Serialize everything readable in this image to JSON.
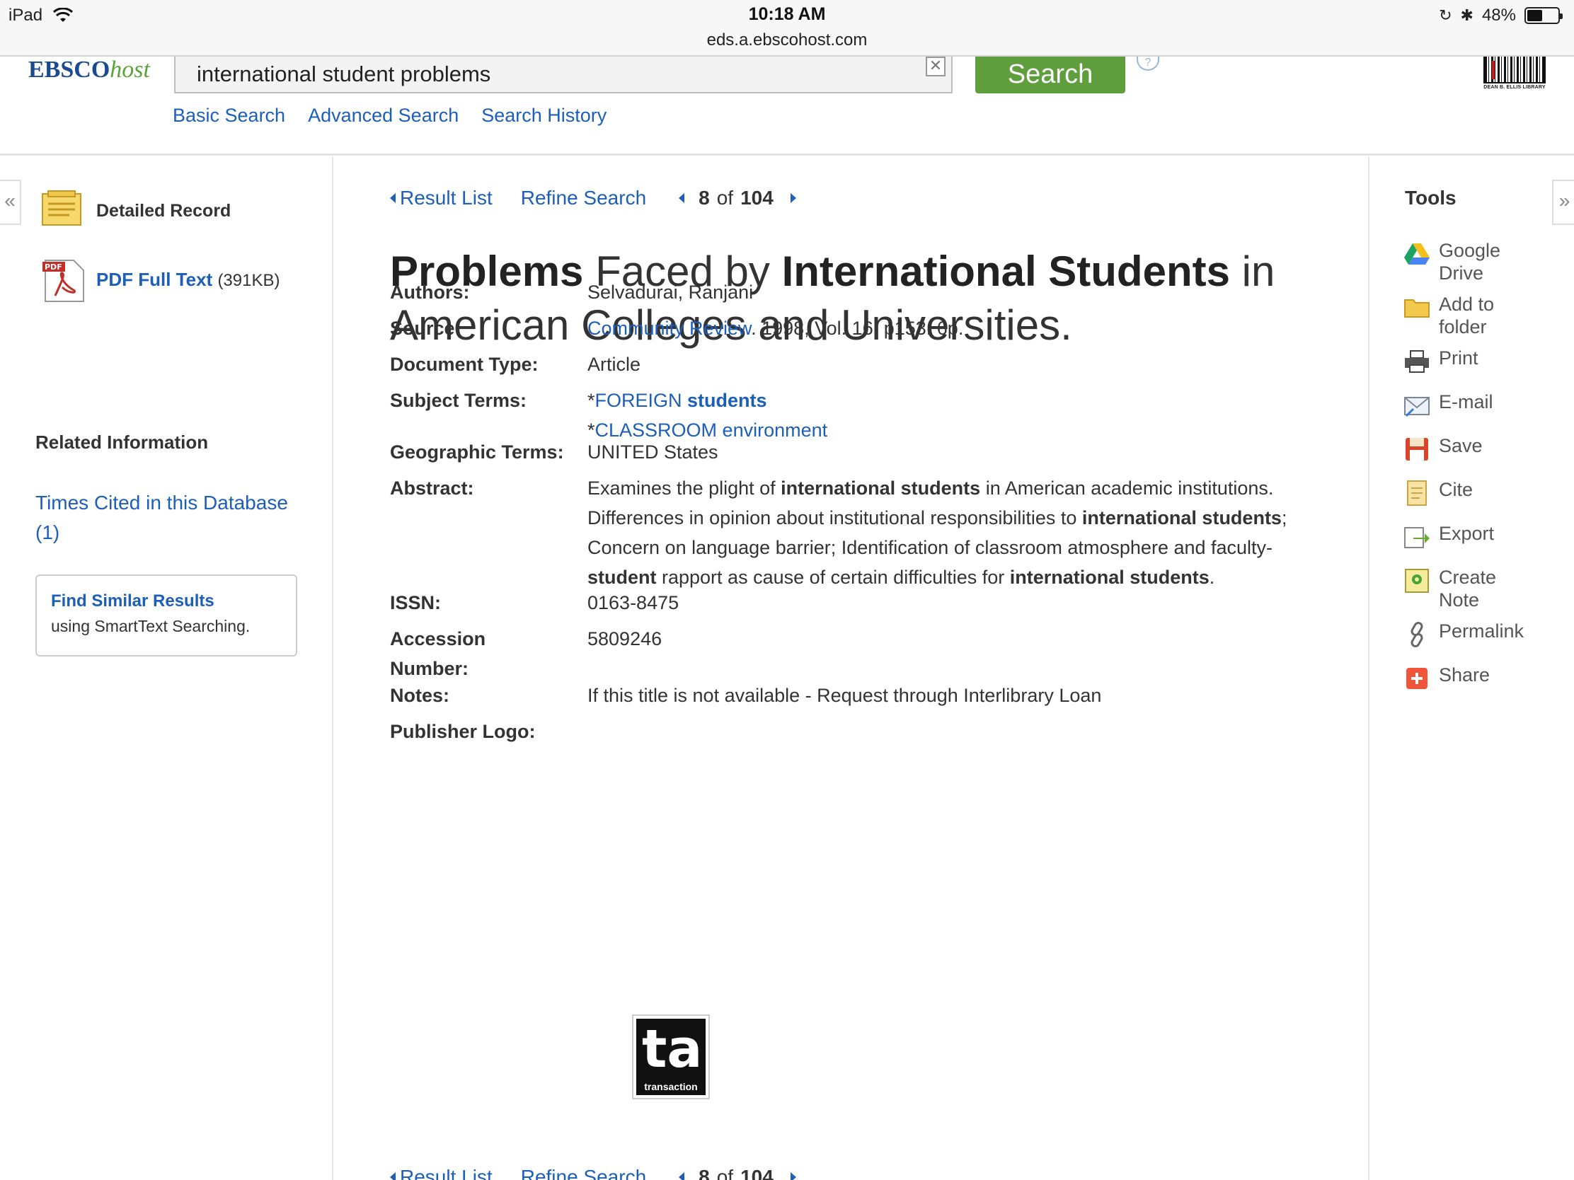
{
  "status_bar": {
    "device": "iPad",
    "time": "10:18 AM",
    "url": "eds.a.ebscohost.com",
    "battery": "48%",
    "battery_level": 0.48
  },
  "header": {
    "logo_main": "EBSCO",
    "logo_sub": "host",
    "search_value": "international student problems",
    "search_button": "Search",
    "links": [
      "Basic Search",
      "Advanced Search",
      "Search History"
    ],
    "library_logo_caption": "DEAN B. ELLIS LIBRARY"
  },
  "left_panel": {
    "detailed_record": "Detailed Record",
    "pdf_link": "PDF Full Text",
    "pdf_size": "(391KB)",
    "pdf_badge": "PDF",
    "related_title": "Related Information",
    "times_cited": "Times Cited in this Database (1)",
    "similar_title": "Find Similar Results",
    "similar_sub": "using SmartText Searching."
  },
  "main": {
    "nav": {
      "result_list": "Result List",
      "refine_search": "Refine Search",
      "current": "8",
      "of": "of",
      "total": "104"
    },
    "title": {
      "p1": "Problems",
      "p2": " Faced by ",
      "p3": "International Students",
      "p4": " in American Colleges and Universities."
    },
    "fields": {
      "authors_label": "Authors:",
      "authors_value": "Selvadurai, Ranjani",
      "source_label": "Source:",
      "source_link": "Community Review",
      "source_rest": ". 1998, Vol. 16, p153. 6p.",
      "doctype_label": "Document Type:",
      "doctype_value": "Article",
      "subject_label": "Subject Terms:",
      "subject1_a": "FOREIGN ",
      "subject1_b": "students",
      "subject2": "CLASSROOM environment",
      "geo_label": "Geographic Terms:",
      "geo_value": "UNITED States",
      "abstract_label": "Abstract:",
      "abstract": [
        "Examines the plight of ",
        "international students",
        " in American academic institutions. Differences in opinion about institutional responsibilities to ",
        "international students",
        "; Concern on language barrier; Identification of classroom atmosphere and faculty-",
        "student",
        " rapport as cause of certain difficulties for ",
        "international students",
        "."
      ],
      "issn_label": "ISSN:",
      "issn_value": "0163-8475",
      "accession_label": "Accession Number:",
      "accession_value": "5809246",
      "notes_label": "Notes:",
      "notes_value": "If this title is not available - Request through Interlibrary Loan",
      "publisher_label": "Publisher Logo:",
      "publisher_logo_caption": "transaction"
    }
  },
  "tools": {
    "title": "Tools",
    "items": [
      "Google Drive",
      "Add to folder",
      "Print",
      "E-mail",
      "Save",
      "Cite",
      "Export",
      "Create Note",
      "Permalink",
      "Share"
    ]
  }
}
